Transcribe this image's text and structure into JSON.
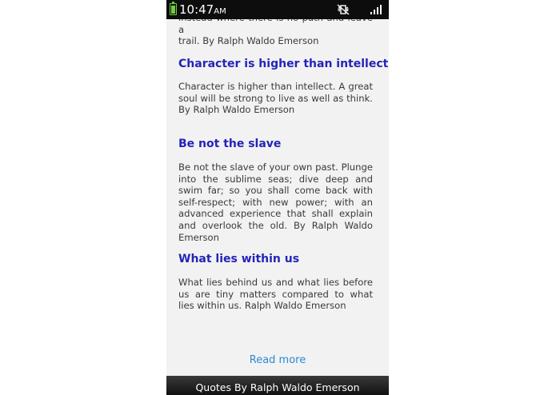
{
  "status_bar": {
    "time": "10:47",
    "ampm": "AM"
  },
  "quotes": {
    "partial_text_line1": "instead where there is no path and leave a",
    "partial_text_line2": "trail. By Ralph Waldo Emerson",
    "items": [
      {
        "title": "Character is higher than intellect",
        "text": "Character is higher than intellect. A great soul will be strong to live as well as think. By Ralph Waldo Emerson"
      },
      {
        "title": "Be not the slave",
        "text": "Be not the slave of your own past. Plunge into the sublime seas; dive deep and swim far; so you shall come back with self-respect; with new power; with an advanced experience that shall explain and overlook the old. By Ralph Waldo Emerson"
      },
      {
        "title": "What lies within us",
        "text": "What lies behind us and what lies before us are tiny matters compared to what lies within us. Ralph Waldo Emerson"
      }
    ]
  },
  "read_more_label": "Read more",
  "footer_title": "Quotes By Ralph Waldo Emerson"
}
